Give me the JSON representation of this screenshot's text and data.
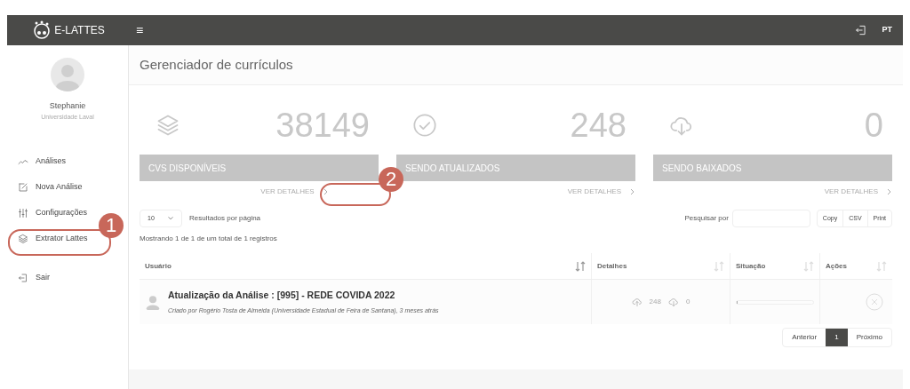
{
  "header": {
    "logo_text": "E-LATTES",
    "menu_glyph": "≡",
    "language": "PT"
  },
  "sidebar": {
    "user_name": "Stephanie",
    "user_org": "Universidade Laval",
    "items": [
      {
        "label": "Análises",
        "kind": "chart"
      },
      {
        "label": "Nova Análise",
        "kind": "edit"
      },
      {
        "label": "Configurações",
        "kind": "sliders"
      },
      {
        "label": "Extrator Lattes",
        "kind": "layers"
      },
      {
        "label": "Sair",
        "kind": "exit"
      }
    ]
  },
  "page_title": "Gerenciador de currículos",
  "stats": [
    {
      "kind": "layers",
      "value": "38149",
      "label": "CVS DISPONÍVEIS",
      "link": "VER DETALHES"
    },
    {
      "kind": "check",
      "value": "248",
      "label": "SENDO ATUALIZADOS",
      "link": "VER DETALHES"
    },
    {
      "kind": "download",
      "value": "0",
      "label": "SENDO BAIXADOS",
      "link": "VER DETALHES"
    }
  ],
  "page_size": {
    "value": "10",
    "label": "Resultados por página"
  },
  "search": {
    "label": "Pesquisar por"
  },
  "export_buttons": [
    "Copy",
    "CSV",
    "Print"
  ],
  "summary": "Mostrando 1 de 1 de um total de 1 registros",
  "table": {
    "columns": [
      {
        "label": "Usuário",
        "sorted": true
      },
      {
        "label": "Detalhes",
        "sorted": false
      },
      {
        "label": "Situação",
        "sorted": false
      },
      {
        "label": "Ações",
        "sorted": false
      }
    ],
    "rows": [
      {
        "title": "Atualização da Análise : [995] - REDE COVIDA 2022",
        "subtitle": "Criado por Rogério Tosta de Almeida (Universidade Estadual de Feira de Santana), 3 meses atrás",
        "uploaded": "248",
        "downloaded": "0",
        "level": 0.01
      }
    ]
  },
  "pagination": [
    {
      "label": "Anterior",
      "selected": false
    },
    {
      "label": "1",
      "selected": true
    },
    {
      "label": "Próximo",
      "selected": false
    }
  ],
  "annotations": [
    {
      "number": "1"
    },
    {
      "number": "2"
    }
  ]
}
